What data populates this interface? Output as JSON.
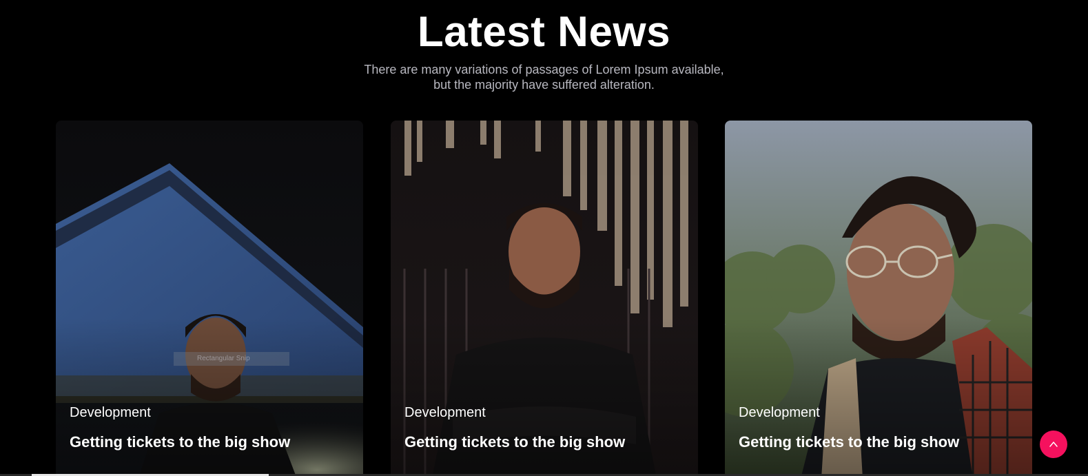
{
  "section": {
    "title": "Latest News",
    "subtitle_line1": "There are many variations of passages of Lorem Ipsum available,",
    "subtitle_line2": "but the majority have suffered alteration."
  },
  "cards": [
    {
      "category": "Development",
      "title": "Getting tickets to the big show",
      "photo": "portrait-man-night-blue-roof"
    },
    {
      "category": "Development",
      "title": "Getting tickets to the big show",
      "photo": "portrait-man-arms-crossed-decorations"
    },
    {
      "category": "Development",
      "title": "Getting tickets to the big show",
      "photo": "portrait-man-glasses-scarf-outdoors"
    }
  ],
  "overlay": {
    "snip_text": "Rectangular Snip"
  },
  "scroll_top": {
    "icon": "chevron-up-icon",
    "color": "#f5115e"
  },
  "colors": {
    "background": "#000000",
    "text": "#ffffff",
    "subtitle": "#b8b8c0",
    "accent": "#f5115e"
  }
}
